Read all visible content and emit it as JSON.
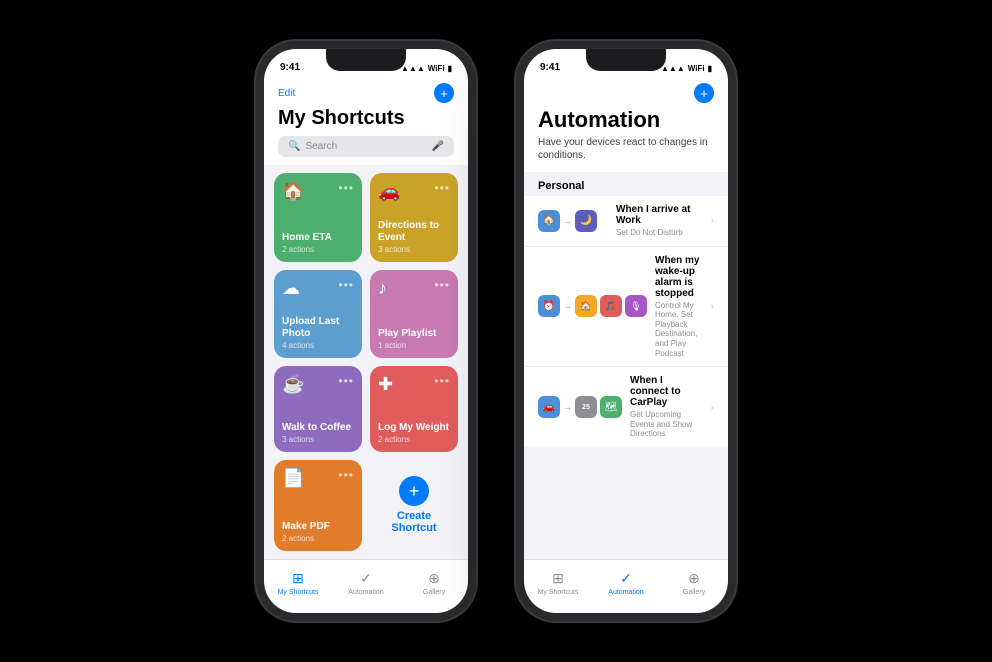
{
  "phone1": {
    "status": {
      "time": "9:41",
      "icons": "▲ ◀ 📶 🔋"
    },
    "header": {
      "edit_label": "Edit",
      "title": "My Shortcuts",
      "search_placeholder": "Search"
    },
    "tiles": [
      {
        "name": "Home ETA",
        "actions": "2 actions",
        "icon": "🏠",
        "color": "#4caf6e"
      },
      {
        "name": "Directions to Event",
        "actions": "3 actions",
        "icon": "🚗",
        "color": "#c9a227"
      },
      {
        "name": "Upload Last Photo",
        "actions": "4 actions",
        "icon": "☁",
        "color": "#5b9ecf"
      },
      {
        "name": "Play Playlist",
        "actions": "1 action",
        "icon": "♪",
        "color": "#c879b0"
      },
      {
        "name": "Walk to Coffee",
        "actions": "3 actions",
        "icon": "☕",
        "color": "#8e6bbf"
      },
      {
        "name": "Log My Weight",
        "actions": "2 actions",
        "icon": "✚",
        "color": "#e05c5c"
      },
      {
        "name": "Make PDF",
        "actions": "2 actions",
        "icon": "📄",
        "color": "#e07c2a"
      }
    ],
    "create_label": "Create Shortcut",
    "tabs": [
      {
        "label": "My Shortcuts",
        "active": true
      },
      {
        "label": "Automation",
        "active": false
      },
      {
        "label": "Gallery",
        "active": false
      }
    ]
  },
  "phone2": {
    "status": {
      "time": "9:41"
    },
    "header": {
      "title": "Automation",
      "subtitle": "Have your devices react to changes in conditions."
    },
    "section": "Personal",
    "automations": [
      {
        "title": "When I arrive at Work",
        "subtitle": "Set Do Not Disturb",
        "icons": [
          "🏠",
          "🌙"
        ],
        "icon_colors": [
          "#4a90d9",
          "#5b5ebf"
        ]
      },
      {
        "title": "When my wake-up alarm is stopped",
        "subtitle": "Control My Home, Set Playback Destination, and Play Podcast",
        "icons": [
          "⏰",
          "🏠",
          "🎵",
          "🎙"
        ],
        "icon_colors": [
          "#4a90d9",
          "#f5a623",
          "#e05c5c",
          "#a855c8"
        ]
      },
      {
        "title": "When I connect to CarPlay",
        "subtitle": "Get Upcoming Events and Show Directions",
        "icons": [
          "🚗",
          "25",
          "🗺"
        ],
        "icon_colors": [
          "#4a90d9",
          "#8e8e93",
          "#4caf6e"
        ]
      }
    ],
    "tabs": [
      {
        "label": "My Shortcuts",
        "active": false
      },
      {
        "label": "Automation",
        "active": true
      },
      {
        "label": "Gallery",
        "active": false
      }
    ]
  }
}
